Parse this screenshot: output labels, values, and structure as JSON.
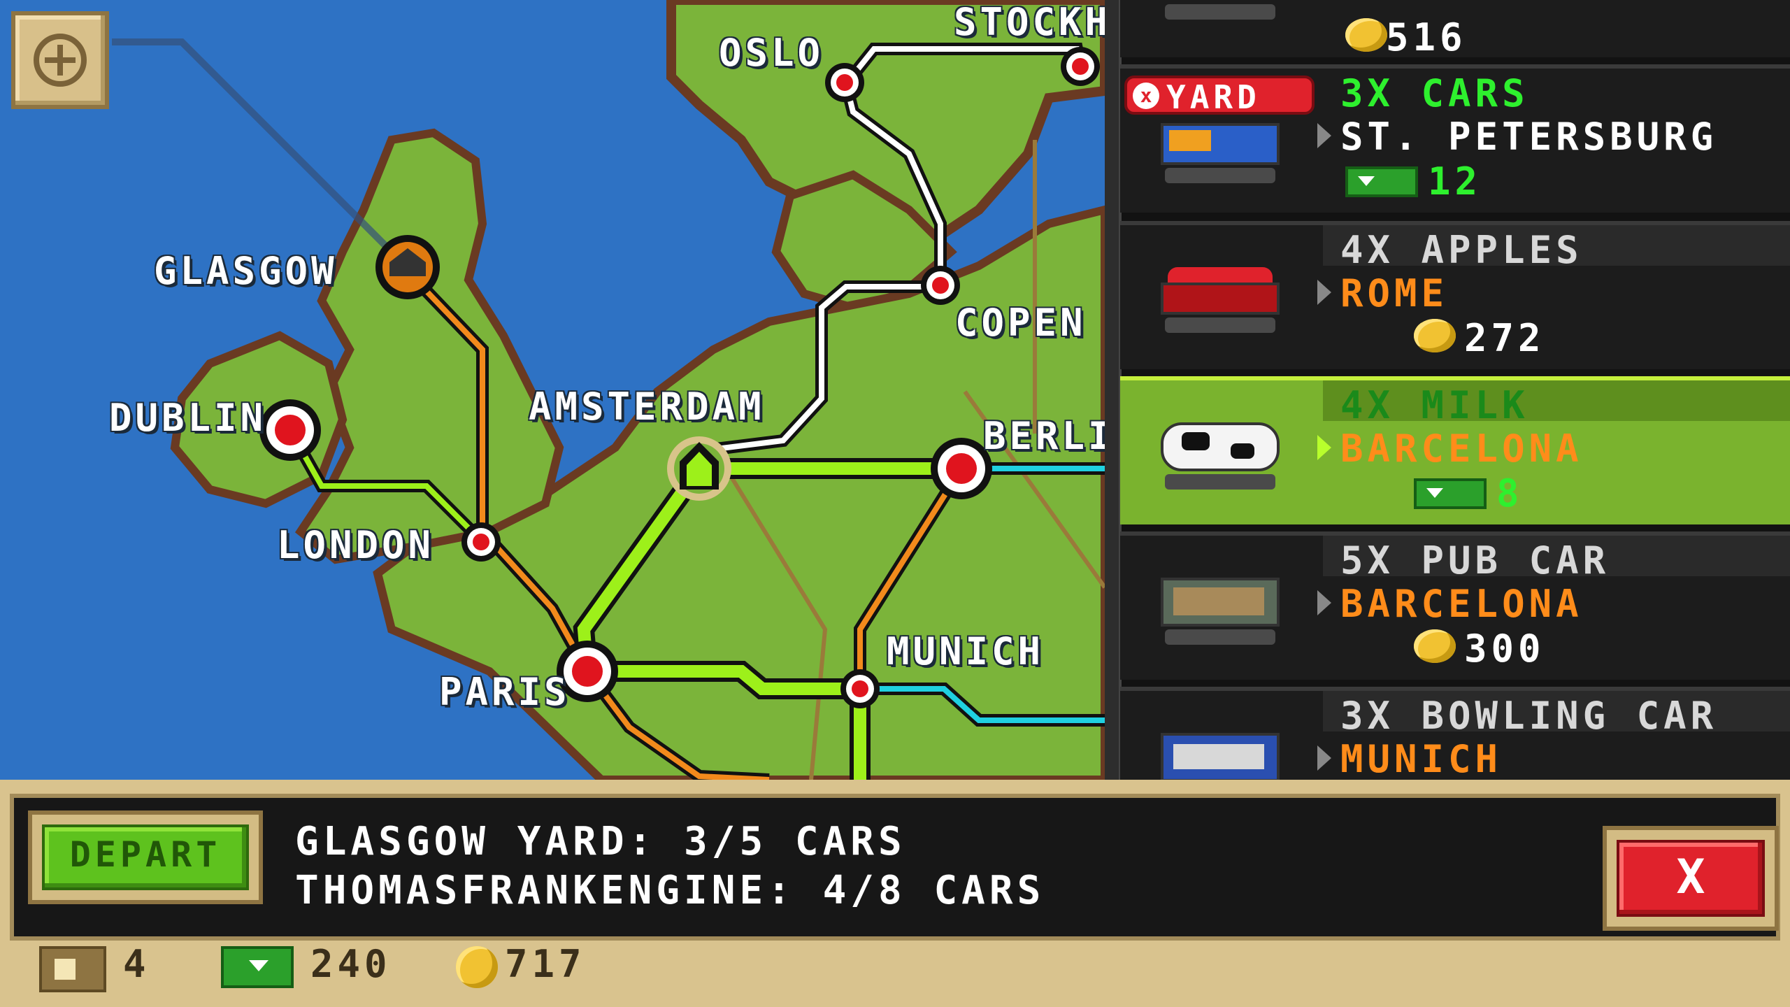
{
  "map": {
    "cities": {
      "oslo": "OSLO",
      "stockholm": "STOCKH",
      "glasgow": "GLASGOW",
      "copenhagen": "COPEN",
      "dublin": "DUBLIN",
      "amsterdam": "AMSTERDAM",
      "berlin": "BERLI",
      "london": "LONDON",
      "munich": "MUNICH",
      "paris": "PARIS"
    },
    "zoom_icon": "plus-icon"
  },
  "orders": [
    {
      "reward": "516",
      "reward_type": "coin"
    },
    {
      "badge": "YARD",
      "title": "3X CARS",
      "destination": "ST. PETERSBURG",
      "reward": "12",
      "reward_type": "cash"
    },
    {
      "title": "4X APPLES",
      "destination": "ROME",
      "reward": "272",
      "reward_type": "coin"
    },
    {
      "title": "4X MILK",
      "destination": "BARCELONA",
      "reward": "8",
      "reward_type": "cash",
      "selected": true
    },
    {
      "title": "5X PUB CAR",
      "destination": "BARCELONA",
      "reward": "300",
      "reward_type": "coin"
    },
    {
      "title": "3X BOWLING CAR",
      "destination": "MUNICH"
    }
  ],
  "bottom_bar": {
    "depart_label": "DEPART",
    "yard_status": "GLASGOW YARD: 3/5 CARS",
    "engine_status": "THOMASFRANKENGINE: 4/8 CARS",
    "close_label": "X"
  },
  "resources": {
    "tickets": "4",
    "cash": "240",
    "coins": "717"
  },
  "colors": {
    "sea": "#2e72c4",
    "land": "#7bb43a",
    "route_selected": "#9df01a",
    "route_orange": "#f28a1c",
    "route_white": "#ffffff",
    "route_cyan": "#1fd0e0",
    "accent_green": "#2ef02e",
    "destination_orange": "#ff8c1a"
  }
}
